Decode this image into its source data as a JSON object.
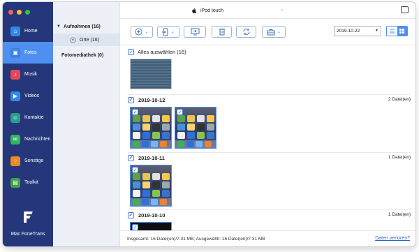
{
  "colors": {
    "sidebar_bg": "#25367a",
    "active_nav": "#4f8ff0",
    "accent": "#2f67c6",
    "traffic_red": "#ff5f57",
    "traffic_yellow": "#febc2e",
    "traffic_green": "#28c840"
  },
  "sidebar": {
    "items": [
      {
        "label": "Home",
        "icon": "home-icon",
        "color": "#2f8be6",
        "glyph": "⌂"
      },
      {
        "label": "Fotos",
        "icon": "photos-icon",
        "color": "#3b82e6",
        "glyph": "▣"
      },
      {
        "label": "Musik",
        "icon": "music-icon",
        "color": "#e54757",
        "glyph": "♪"
      },
      {
        "label": "Videos",
        "icon": "video-icon",
        "color": "#2f8be6",
        "glyph": "▶"
      },
      {
        "label": "Kontakte",
        "icon": "contacts-icon",
        "color": "#2a9d8f",
        "glyph": "☺"
      },
      {
        "label": "Nachrichten",
        "icon": "messages-icon",
        "color": "#31b45c",
        "glyph": "✉"
      },
      {
        "label": "Sonstige",
        "icon": "other-icon",
        "color": "#f08a24",
        "glyph": "⁘"
      },
      {
        "label": "Toolkit",
        "icon": "toolkit-icon",
        "color": "#43a047",
        "glyph": "▤"
      }
    ],
    "active_index": 1,
    "brand": "Mac FoneTrans"
  },
  "tree": {
    "group_label": "Aufnahmen (16)",
    "sub_label": "Orte (16)",
    "library_label": "Fotomediathek (0)"
  },
  "titlebar": {
    "device": "iPod touch"
  },
  "toolbar": {
    "date_value": "2019-10-22"
  },
  "content": {
    "select_all_label": "Alles auswählen (16)",
    "sections": [
      {
        "date": "2019-10-12",
        "count": "2 Datei(en)"
      },
      {
        "date": "2019-10-11",
        "count": "1 Datei(en)"
      },
      {
        "date": "2019-10-10",
        "count": "1 Datei(en)"
      }
    ]
  },
  "status": {
    "summary": "Insgesamt: 16 Datei(en)/7.31 MB; Ausgewählt: 16 Datei(en)/7.31 MB",
    "lost_link": "Daten verloren?"
  }
}
